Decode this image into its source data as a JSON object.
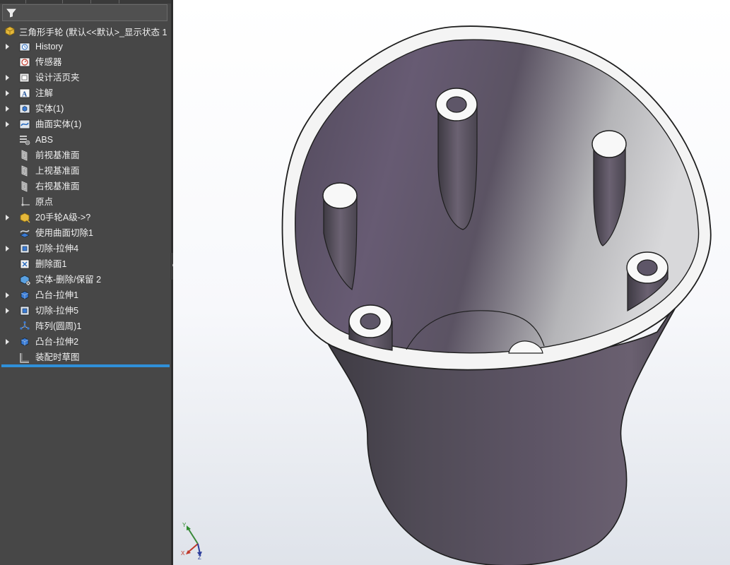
{
  "feature_tree": {
    "root_label": "三角形手轮  (默认<<默认>_显示状态 1",
    "items": [
      {
        "label": "History",
        "icon": "history-folder-icon",
        "expandable": true
      },
      {
        "label": "传感器",
        "icon": "sensor-icon",
        "expandable": false
      },
      {
        "label": "设计活页夹",
        "icon": "design-binder-icon",
        "expandable": true
      },
      {
        "label": "注解",
        "icon": "annotation-icon",
        "expandable": true
      },
      {
        "label": "实体(1)",
        "icon": "solid-bodies-icon",
        "expandable": true
      },
      {
        "label": "曲面实体(1)",
        "icon": "surface-bodies-icon",
        "expandable": true
      },
      {
        "label": "ABS",
        "icon": "material-icon",
        "expandable": false
      },
      {
        "label": "前视基准面",
        "icon": "plane-icon",
        "expandable": false
      },
      {
        "label": "上视基准面",
        "icon": "plane-icon",
        "expandable": false
      },
      {
        "label": "右视基准面",
        "icon": "plane-icon",
        "expandable": false
      },
      {
        "label": "原点",
        "icon": "origin-icon",
        "expandable": false
      },
      {
        "label": "20手轮A级->?",
        "icon": "derived-part-icon",
        "expandable": true
      },
      {
        "label": "使用曲面切除1",
        "icon": "surface-cut-icon",
        "expandable": false
      },
      {
        "label": "切除-拉伸4",
        "icon": "cut-extrude-icon",
        "expandable": true
      },
      {
        "label": "删除面1",
        "icon": "delete-face-icon",
        "expandable": false
      },
      {
        "label": "实体-删除/保留 2",
        "icon": "delete-body-icon",
        "expandable": false
      },
      {
        "label": "凸台-拉伸1",
        "icon": "boss-extrude-icon",
        "expandable": true
      },
      {
        "label": "切除-拉伸5",
        "icon": "cut-extrude-icon",
        "expandable": true
      },
      {
        "label": "阵列(圆周)1",
        "icon": "circular-pattern-icon",
        "expandable": false
      },
      {
        "label": "凸台-拉伸2",
        "icon": "boss-extrude-icon",
        "expandable": true
      },
      {
        "label": "装配时草图",
        "icon": "sketch-folder-icon",
        "expandable": false
      }
    ]
  },
  "triad": {
    "x": "X",
    "y": "Y",
    "z": "Z"
  },
  "colors": {
    "panel_bg": "#474747",
    "rollback_bar": "#2f8fd8",
    "model_body": "#58505e"
  }
}
